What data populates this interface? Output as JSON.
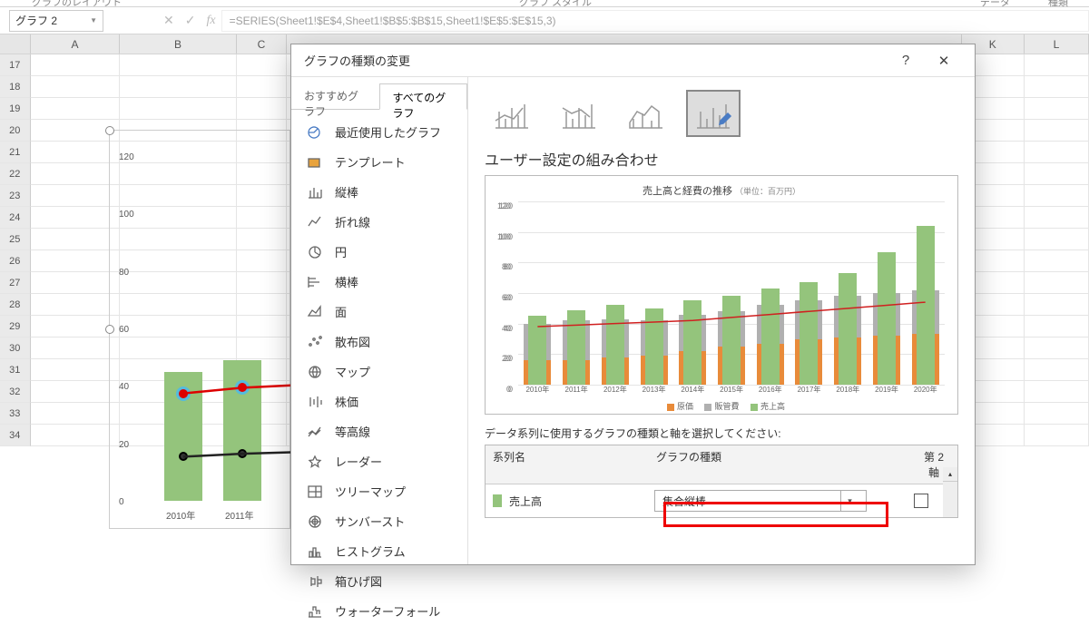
{
  "ribbon": {
    "left": "グラフのレイアウト",
    "mid": "グラフ スタイル",
    "r1": "データ",
    "r2": "種類"
  },
  "namebox": "グラフ 2",
  "formula": "=SERIES(Sheet1!$E$4,Sheet1!$B$5:$B$15,Sheet1!$E$5:$E$15,3)",
  "cols": [
    "A",
    "B",
    "C",
    "K",
    "L"
  ],
  "dialog": {
    "title": "グラフの種類の変更",
    "tabs": {
      "recommended": "おすすめグラフ",
      "all": "すべてのグラフ"
    },
    "cats": [
      "最近使用したグラフ",
      "テンプレート",
      "縦棒",
      "折れ線",
      "円",
      "横棒",
      "面",
      "散布図",
      "マップ",
      "株価",
      "等高線",
      "レーダー",
      "ツリーマップ",
      "サンバースト",
      "ヒストグラム",
      "箱ひげ図",
      "ウォーターフォール"
    ],
    "section_title": "ユーザー設定の組み合わせ",
    "preview_title": "売上高と経費の推移",
    "preview_sub": "（単位：百万円）",
    "legend": {
      "a": "原価",
      "b": "販管費",
      "c": "売上高"
    },
    "series_prompt": "データ系列に使用するグラフの種類と軸を選択してください:",
    "hdr": {
      "name": "系列名",
      "type": "グラフの種類",
      "axis": "第 2 軸"
    },
    "row1": {
      "name": "売上高",
      "type": "集合縦棒"
    }
  },
  "chart_data": {
    "type": "bar",
    "title": "売上高と経費の推移（単位：百万円）",
    "categories": [
      "2010年",
      "2011年",
      "2012年",
      "2013年",
      "2014年",
      "2015年",
      "2016年",
      "2017年",
      "2018年",
      "2019年",
      "2020年"
    ],
    "ylim": [
      0,
      120
    ],
    "y_ticks": [
      0,
      20,
      40,
      60,
      80,
      100,
      120
    ],
    "series": [
      {
        "name": "売上高",
        "type": "bar",
        "color": "#94c47c",
        "values": [
          45,
          49,
          52,
          50,
          55,
          58,
          63,
          67,
          73,
          87,
          104
        ]
      },
      {
        "name": "販管費",
        "type": "area",
        "color": "#b0b0b0",
        "values": [
          40,
          42,
          43,
          42,
          46,
          48,
          52,
          55,
          58,
          60,
          62
        ]
      },
      {
        "name": "原価",
        "type": "area",
        "color": "#e88b3a",
        "values": [
          16,
          16,
          18,
          19,
          22,
          25,
          27,
          30,
          31,
          32,
          33
        ]
      }
    ],
    "red_line": [
      38,
      39,
      40,
      41,
      42,
      44,
      46,
      48,
      50,
      52,
      54
    ]
  },
  "sheet_chart": {
    "categories": [
      "2010年",
      "2011年"
    ],
    "y_ticks": [
      0,
      20,
      40,
      60,
      80,
      100,
      120
    ],
    "bars": [
      45,
      49
    ],
    "red_line": [
      38,
      40
    ],
    "black_line": [
      16,
      17
    ]
  }
}
